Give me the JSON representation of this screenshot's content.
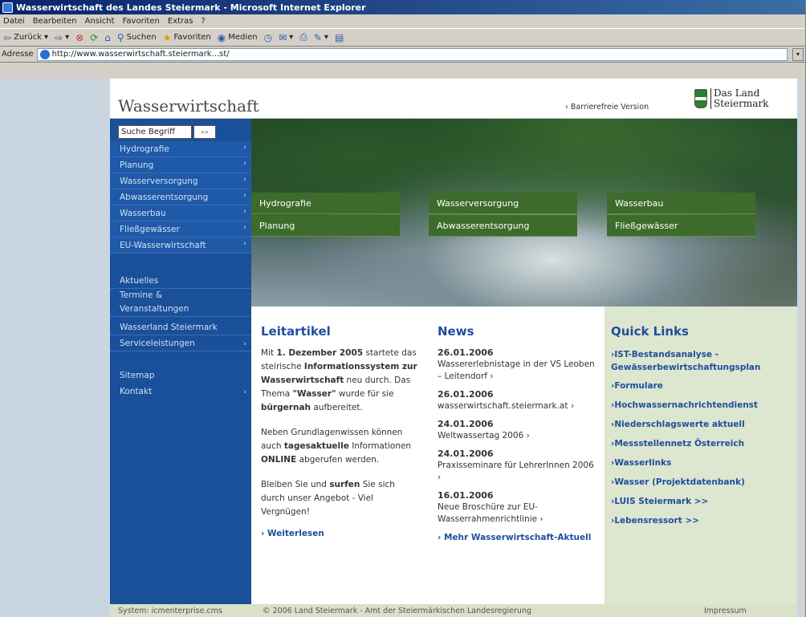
{
  "window": {
    "title": "Wasserwirtschaft des Landes Steiermark - Microsoft Internet Explorer"
  },
  "menubar": [
    "Datei",
    "Bearbeiten",
    "Ansicht",
    "Favoriten",
    "Extras",
    "?"
  ],
  "toolbar": {
    "back": "Zurück",
    "search": "Suchen",
    "favorites": "Favoriten",
    "media": "Medien"
  },
  "addressbar": {
    "label": "Adresse",
    "url": "http://www.wasserwirtschaft.steiermark...st/"
  },
  "header": {
    "site_title": "Wasserwirtschaft",
    "barrierefrei": "› Barrierefreie Version",
    "logo_line1": "Das Land",
    "logo_line2": "Steiermark"
  },
  "search": {
    "value": "Suche Begriff",
    "go": "»»"
  },
  "leftnav": {
    "main": [
      {
        "label": "Hydrografie",
        "arrow": "›"
      },
      {
        "label": "Planung",
        "arrow": "›"
      },
      {
        "label": "Wasserversorgung",
        "arrow": "›"
      },
      {
        "label": "Abwasserentsorgung",
        "arrow": "›"
      },
      {
        "label": "Wasserbau",
        "arrow": "›"
      },
      {
        "label": "Fließgewässer",
        "arrow": "›"
      },
      {
        "label": "EU-Wasserwirtschaft",
        "arrow": "›"
      }
    ],
    "secondary": [
      {
        "label": "Aktuelles",
        "arrow": ""
      },
      {
        "label": "Termine & Veranstaltungen",
        "arrow": ""
      },
      {
        "label": "Wasserland Steiermark",
        "arrow": ""
      },
      {
        "label": "Serviceleistungen",
        "arrow": "›"
      }
    ],
    "tertiary": [
      {
        "label": "Sitemap",
        "arrow": ""
      },
      {
        "label": "Kontakt",
        "arrow": "›"
      }
    ]
  },
  "hero": {
    "buttons": [
      [
        "Hydrografie",
        "Planung"
      ],
      [
        "Wasserversorgung",
        "Abwasserentsorgung"
      ],
      [
        "Wasserbau",
        "Fließgewässer"
      ]
    ]
  },
  "leitartikel": {
    "title": "Leitartikel",
    "p1_a": "Mit ",
    "p1_b": "1. Dezember 2005",
    "p1_c": " startete das steirische ",
    "p1_d": "Informationssystem zur Wasserwirtschaft",
    "p1_e": " neu durch. Das Thema ",
    "p1_f": "\"Wasser\"",
    "p1_g": " wurde für sie ",
    "p1_h": "bürgernah",
    "p1_i": " aufbereitet.",
    "p2_a": "Neben Grundlagenwissen können auch ",
    "p2_b": "tagesaktuelle",
    "p2_c": " Informationen ",
    "p2_d": "ONLINE",
    "p2_e": " abgerufen werden.",
    "p3_a": "Bleiben Sie und ",
    "p3_b": "surfen",
    "p3_c": " Sie sich durch unser Angebot - Viel Vergnügen!",
    "more": "› Weiterlesen"
  },
  "news": {
    "title": "News",
    "items": [
      {
        "date": "26.01.2006",
        "text": "Wassererlebnistage in der VS Leoben – Leitendorf ›"
      },
      {
        "date": "26.01.2006",
        "text": "wasserwirtschaft.steiermark.at ›"
      },
      {
        "date": "24.01.2006",
        "text": "Weltwassertag 2006 ›"
      },
      {
        "date": "24.01.2006",
        "text": "Praxisseminare für LehrerInnen 2006 ›"
      },
      {
        "date": "16.01.2006",
        "text": "Neue Broschüre zur EU-Wasserrahmenrichtlinie ›"
      }
    ],
    "more": "› Mehr Wasserwirtschaft-Aktuell"
  },
  "quicklinks": {
    "title": "Quick Links",
    "items": [
      "›IST-Bestandsanalyse - Gewässerbewirtschaftungsplan",
      "›Formulare",
      "›Hochwassernachrichtendienst",
      "›Niederschlagswerte aktuell",
      "›Messstellennetz Österreich",
      "›Wasserlinks",
      "›Wasser (Projektdatenbank)",
      "›LUIS Steiermark >>",
      "›Lebensressort >>"
    ]
  },
  "footer": {
    "system": "System: icmenterprise.cms",
    "copyright": "© 2006 Land Steiermark - Amt der Steiermärkischen Landesregierung",
    "impressum": "Impressum"
  },
  "colors": {
    "nav_blue": "#1f5aa8",
    "title_blue": "#1f4e9c",
    "hero_green": "#3d6b2c",
    "quicklinks_bg": "#dde6cf"
  }
}
